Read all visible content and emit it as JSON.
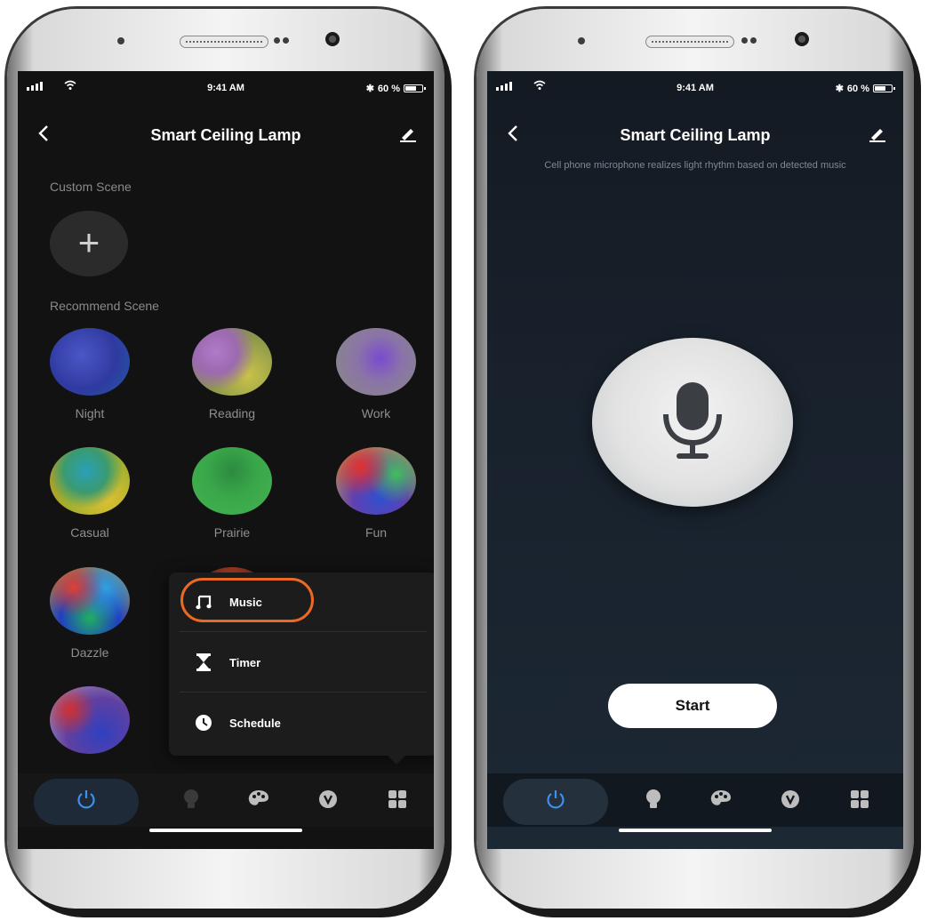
{
  "status": {
    "time": "9:41 AM",
    "battery": "60 %"
  },
  "left_screen": {
    "title": "Smart Ceiling Lamp",
    "custom_scene_label": "Custom Scene",
    "add_symbol": "+",
    "recommend_scene_label": "Recommend Scene",
    "scenes": [
      {
        "label": "Night"
      },
      {
        "label": "Reading"
      },
      {
        "label": "Work"
      },
      {
        "label": "Casual"
      },
      {
        "label": "Prairie"
      },
      {
        "label": "Fun"
      },
      {
        "label": "Dazzle"
      }
    ],
    "menu": [
      {
        "label": "Music",
        "icon": "music-note-icon",
        "highlighted": true
      },
      {
        "label": "Timer",
        "icon": "hourglass-icon"
      },
      {
        "label": "Schedule",
        "icon": "clock-icon"
      }
    ],
    "highlight_color": "#ea6a24"
  },
  "right_screen": {
    "title": "Smart Ceiling Lamp",
    "description": "Cell phone microphone realizes light rhythm based on detected music",
    "start_label": "Start"
  },
  "bottom_tabs": [
    "power-icon",
    "bulb-icon",
    "palette-icon",
    "scene-icon",
    "grid-icon"
  ],
  "accent_color": "#3d8ff0"
}
